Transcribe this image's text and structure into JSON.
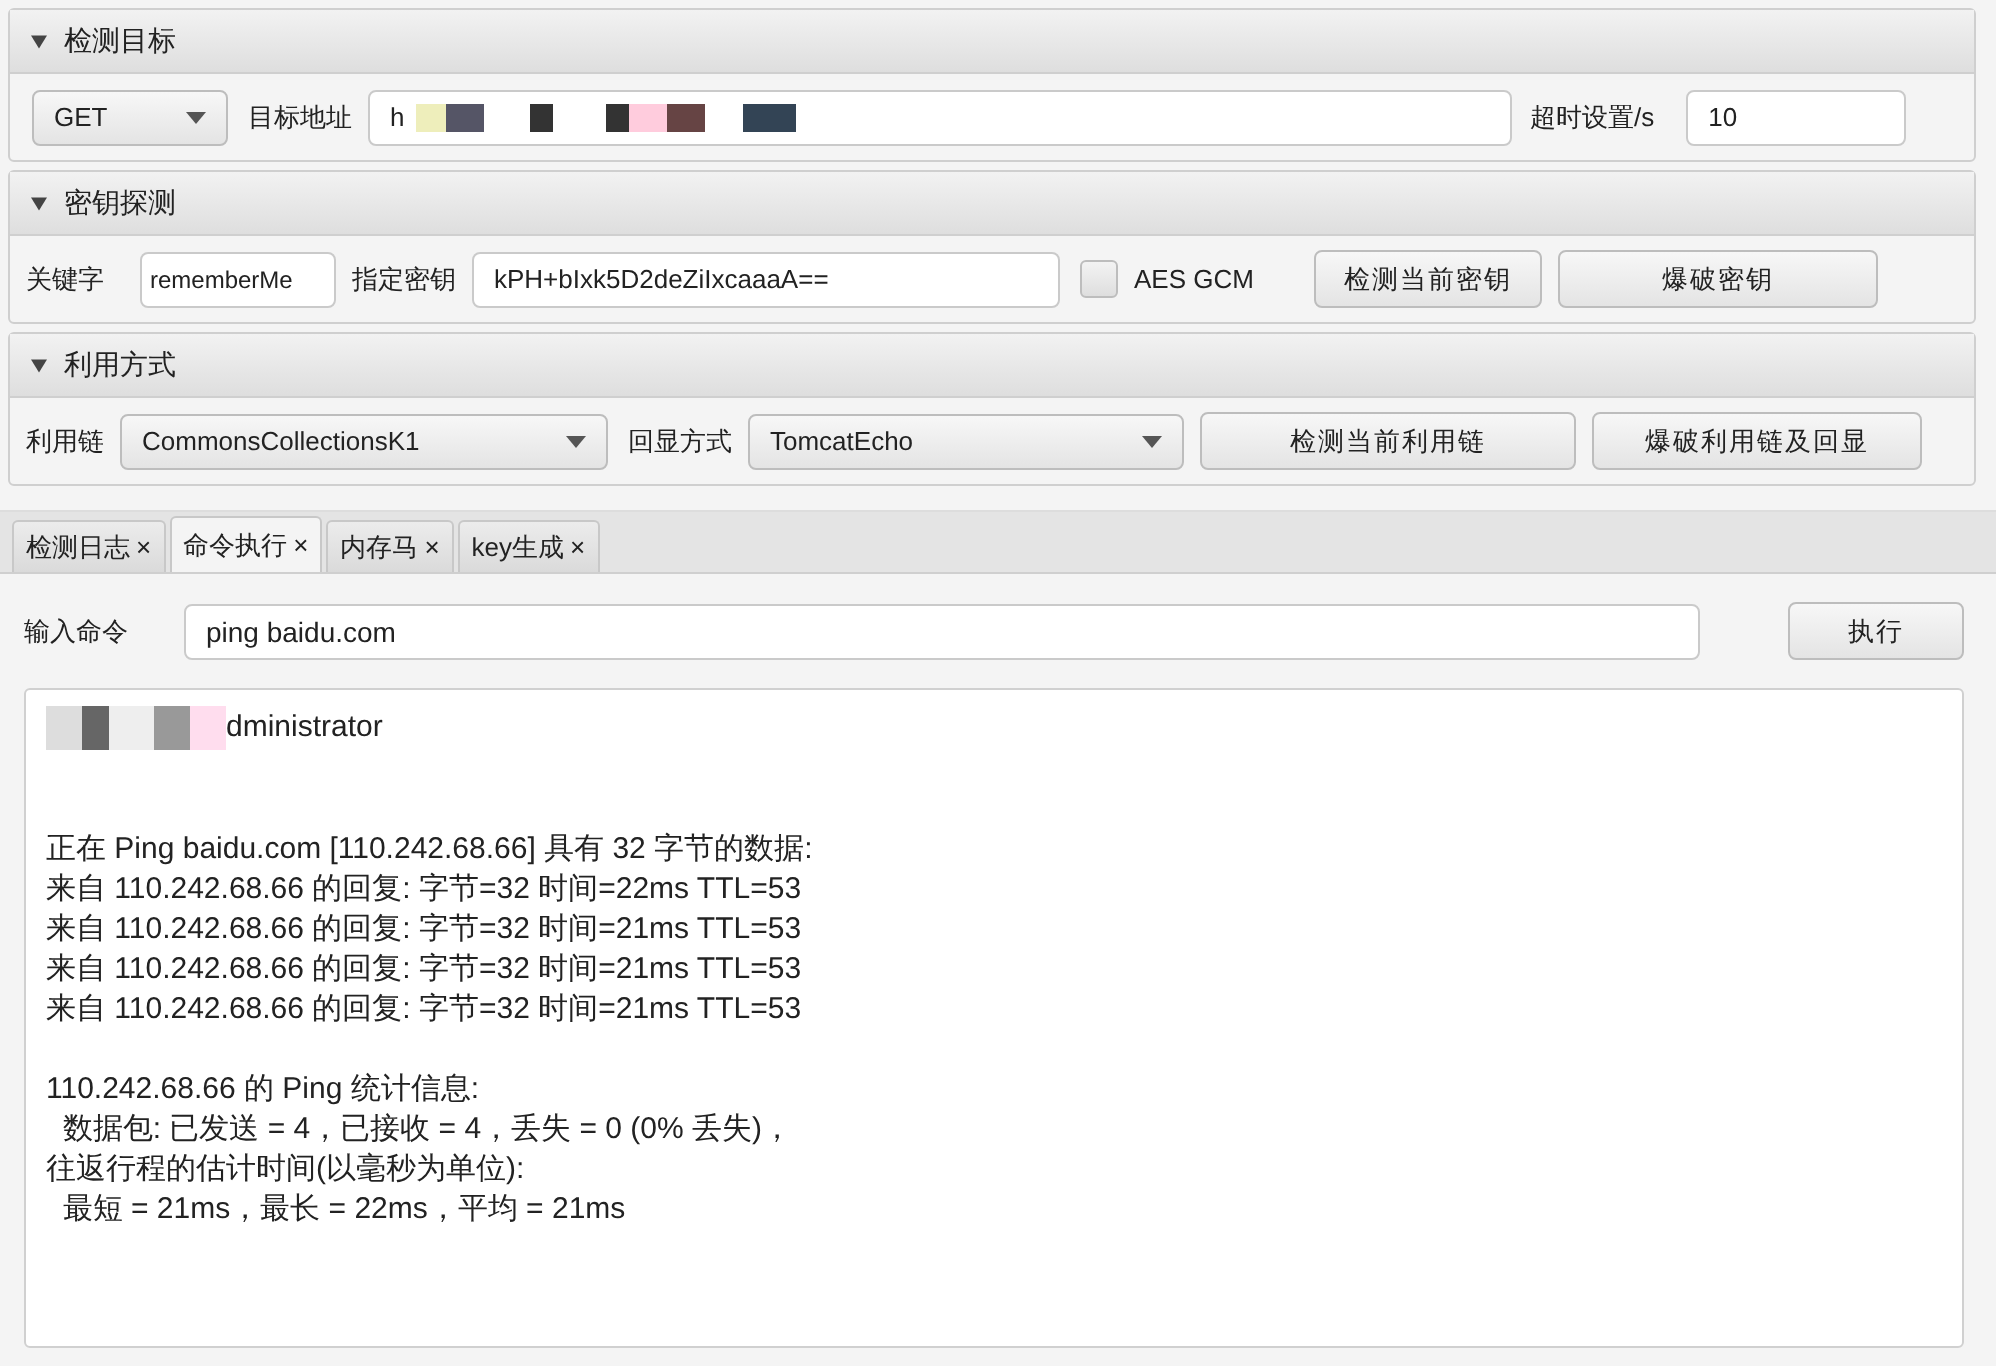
{
  "target": {
    "title": "检测目标",
    "expanded": true,
    "method": "GET",
    "url_label": "目标地址",
    "url_value": "h",
    "timeout_label": "超时设置/s",
    "timeout_value": "10"
  },
  "key_probe": {
    "title": "密钥探测",
    "expanded": true,
    "keyword_label": "关键字",
    "keyword_value": "rememberMe",
    "key_label": "指定密钥",
    "key_value": "kPH+bIxk5D2deZiIxcaaaA==",
    "aes_gcm": {
      "label": "AES GCM",
      "checked": false
    },
    "buttons": [
      "检测当前密钥",
      "爆破密钥"
    ]
  },
  "exploit": {
    "title": "利用方式",
    "expanded": true,
    "chain_label": "利用链",
    "chain_value": "CommonsCollectionsK1",
    "echo_label": "回显方式",
    "echo_value": "TomcatEcho",
    "buttons": [
      "检测当前利用链",
      "爆破利用链及回显"
    ]
  },
  "tabs": [
    {
      "label": "检测日志",
      "close": "×",
      "selected": false
    },
    {
      "label": "命令执行",
      "close": "×",
      "selected": true
    },
    {
      "label": "内存马",
      "close": "×",
      "selected": false
    },
    {
      "label": "key生成",
      "close": "×",
      "selected": false
    }
  ],
  "command": {
    "label": "输入命令",
    "value": "ping baidu.com",
    "button": "执行"
  },
  "output": {
    "user_line": "dministrator",
    "blocks": [
      [
        "正在 Ping baidu.com [110.242.68.66] 具有 32 字节的数据:",
        "来自 110.242.68.66 的回复: 字节=32 时间=22ms TTL=53",
        "来自 110.242.68.66 的回复: 字节=32 时间=21ms TTL=53",
        "来自 110.242.68.66 的回复: 字节=32 时间=21ms TTL=53",
        "来自 110.242.68.66 的回复: 字节=32 时间=21ms TTL=53"
      ],
      [
        "110.242.68.66 的 Ping 统计信息:",
        "  数据包: 已发送 = 4，已接收 = 4，丢失 = 0 (0% 丢失)，",
        "往返行程的估计时间(以毫秒为单位):",
        "  最短 = 21ms，最长 = 22ms，平均 = 21ms"
      ]
    ]
  }
}
